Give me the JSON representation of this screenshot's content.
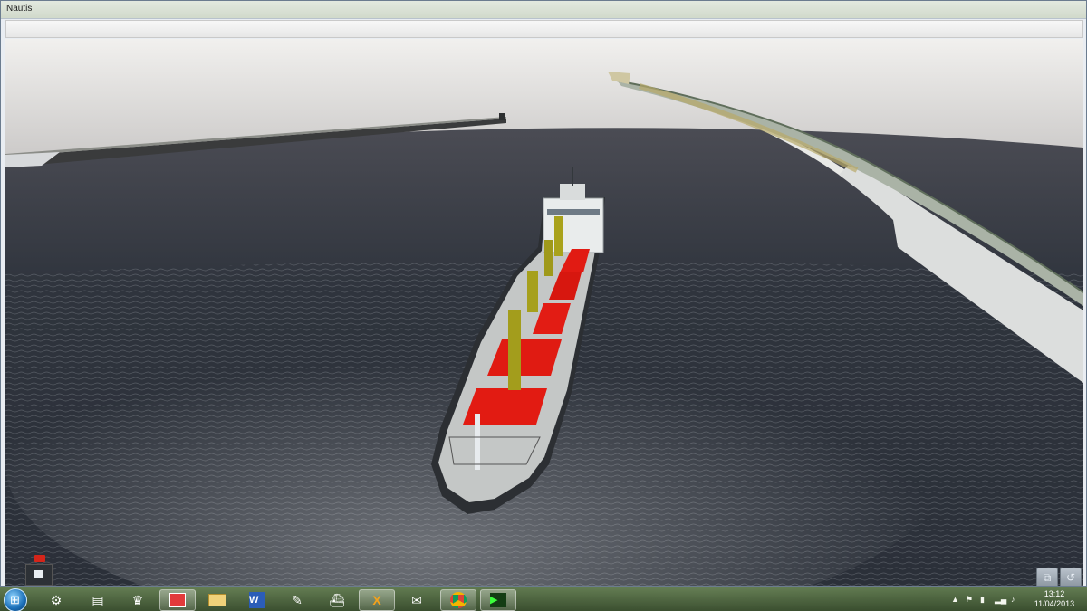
{
  "window": {
    "title": "Nautis"
  },
  "scene": {
    "description_colors": {
      "sea": "#2f3640",
      "sky": "#dcdad8",
      "ship_deck": "#bfc3c2",
      "hatch_red": "#e01b12",
      "crane_yellow": "#a8a21c"
    }
  },
  "hud": {
    "left_icons": [
      "red-light-icon",
      "engine-telegraph-icon",
      "steering-wheel-icon",
      "throttle-icon"
    ],
    "right_toolbar": [
      {
        "icon": "camera-icon",
        "active": false
      },
      {
        "icon": "rotate-icon",
        "active": false
      },
      {
        "icon": "bridge-view-icon",
        "active": false
      },
      {
        "icon": "compass-icon",
        "active": false
      },
      {
        "icon": "person-icon",
        "active": false
      },
      {
        "icon": "ship-icon",
        "active": false
      },
      {
        "icon": "lights-icon",
        "active": false
      },
      {
        "icon": "pointer-icon",
        "active": true
      },
      {
        "icon": "record-icon",
        "active": false
      }
    ]
  },
  "taskbar": {
    "apps": [
      {
        "icon": "settings-gear-icon",
        "open": false
      },
      {
        "icon": "document-icon",
        "open": false
      },
      {
        "icon": "crest-icon",
        "open": false
      },
      {
        "icon": "chart-app-icon",
        "open": true
      },
      {
        "icon": "folder-icon",
        "open": false
      },
      {
        "icon": "word-icon",
        "open": false
      },
      {
        "icon": "notepad-icon",
        "open": false
      },
      {
        "icon": "ship-app-icon",
        "open": false
      },
      {
        "icon": "x-app-icon",
        "open": true
      },
      {
        "icon": "bird-app-icon",
        "open": false
      },
      {
        "icon": "chrome-icon",
        "open": true
      },
      {
        "icon": "player-icon",
        "open": true
      }
    ],
    "clock": {
      "time": "13:12",
      "date": "11/04/2013"
    }
  }
}
